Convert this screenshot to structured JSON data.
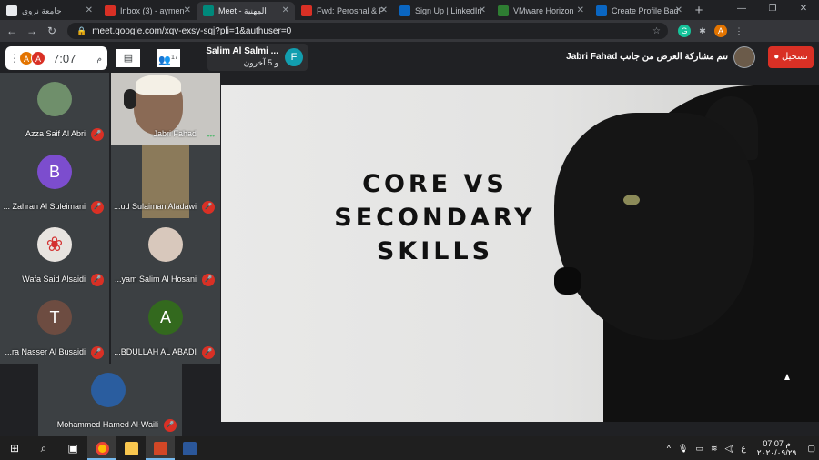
{
  "browser": {
    "tabs": [
      {
        "label": "جامعة نزوى",
        "color": "#e8eaed"
      },
      {
        "label": "Inbox (3) - aymen",
        "color": "#d93025"
      },
      {
        "label": "Meet - المهنية",
        "color": "#00897b",
        "active": true
      },
      {
        "label": "Fwd: Perosnal & P",
        "color": "#d93025"
      },
      {
        "label": "Sign Up | LinkedIn",
        "color": "#0a66c2"
      },
      {
        "label": "VMware Horizon",
        "color": "#2e7d32"
      },
      {
        "label": "Create Profile Bad",
        "color": "#0a66c2"
      }
    ],
    "new_tab": "+",
    "url": "meet.google.com/xqv-exsy-sqj?pli=1&authuser=0"
  },
  "meet": {
    "time": "7:07",
    "ampm": "م",
    "participant_count": "17",
    "presenter_box": {
      "name": "Salim Al Salmi ...",
      "others": "و 5 آخرون",
      "initial": "F"
    },
    "presenting_text": "تتم مشاركة العرض من جانب",
    "presenter_name": "Jabri Fahad",
    "record_label": "تسجيل",
    "participants": [
      {
        "name": "Azza Saif Al Abri",
        "initial": "",
        "color": "#6f8f6b"
      },
      {
        "name": "Jabri Fahad",
        "initial": "",
        "color": "#c8c6c2"
      },
      {
        "name": "... Zahran Al Suleimani",
        "initial": "B",
        "color": "#7c4dce"
      },
      {
        "name": "...ud Sulaiman Aladawi",
        "initial": "",
        "color": "#3c4043"
      },
      {
        "name": "Wafa Said Alsaidi",
        "initial": "",
        "color": "#e8e4e0"
      },
      {
        "name": "...yam Salim Al Hosani",
        "initial": "",
        "color": "#d8c8bc"
      },
      {
        "name": "...ra Nasser Al Busaidi",
        "initial": "T",
        "color": "#6d4c41"
      },
      {
        "name": "...BDULLAH AL ABADI",
        "initial": "A",
        "color": "#33691e"
      },
      {
        "name": "Mohammed Hamed Al-Waili",
        "initial": "",
        "color": "#2a5d9f"
      }
    ],
    "slide_title": [
      "CORE VS",
      "SECONDARY",
      "SKILLS"
    ]
  },
  "taskbar": {
    "time": "07:07 م",
    "date": "٢٠٢٠/٠٩/٢٩",
    "lang": "ع"
  }
}
